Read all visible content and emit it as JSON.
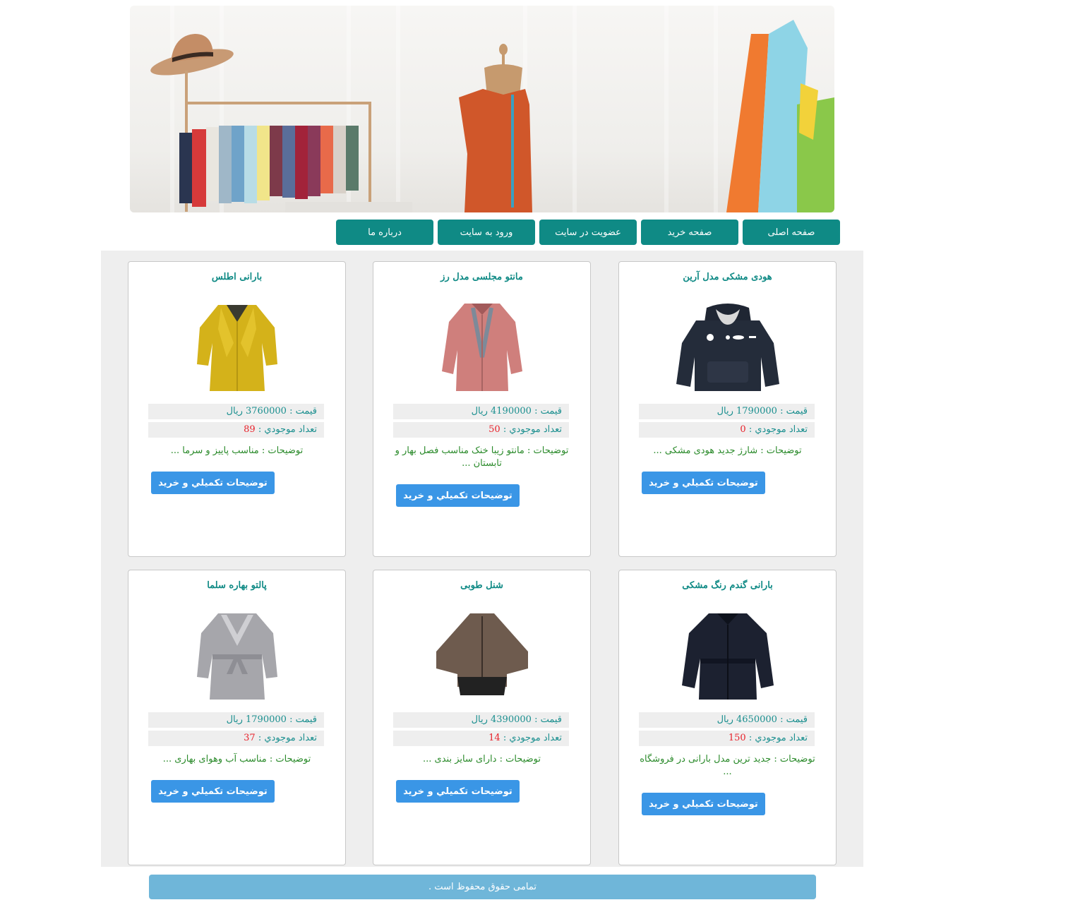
{
  "nav": {
    "items": [
      {
        "label": "صفحه اصلی"
      },
      {
        "label": "صفحه خرید"
      },
      {
        "label": "عضویت در سایت"
      },
      {
        "label": "ورود به سایت"
      },
      {
        "label": "درباره ما"
      }
    ]
  },
  "labels": {
    "price_prefix": "قیمت :",
    "currency": "ریال",
    "stock_prefix": "تعداد موجودي :",
    "desc_prefix": "توضیحات :",
    "buy_button": "توضيحات تکميلي و خريد"
  },
  "products": [
    {
      "title": "هودی مشکی مدل آرین",
      "price": "1790000",
      "stock": "0",
      "desc": "شارژ جدید هودی مشکی ...",
      "image_icon": "black-hoodie-image"
    },
    {
      "title": "مانتو مجلسی مدل رز",
      "price": "4190000",
      "stock": "50",
      "desc": "مانتو زیبا خنک مناسب فصل بهار و تابستان ...",
      "image_icon": "pink-coat-image"
    },
    {
      "title": "بارانی اطلس",
      "price": "3760000",
      "stock": "89",
      "desc": "مناسب پاییز و سرما ...",
      "image_icon": "yellow-raincoat-image"
    },
    {
      "title": "بارانی گندم رنگ مشکی",
      "price": "4650000",
      "stock": "150",
      "desc": "جدید ترین مدل بارانی در فروشگاه ...",
      "image_icon": "black-raincoat-image"
    },
    {
      "title": "شنل طوبی",
      "price": "4390000",
      "stock": "14",
      "desc": "دارای سایز بندی ...",
      "image_icon": "brown-cape-image"
    },
    {
      "title": "پالتو بهاره سلما",
      "price": "1790000",
      "stock": "37",
      "desc": "مناسب آب وهوای بهاری ...",
      "image_icon": "grey-coat-image"
    }
  ],
  "footer": {
    "text": "تمامی حقوق محفوظ است ."
  },
  "colors": {
    "nav": "#0f8a85",
    "title": "#0f8a85",
    "stock_value": "#e8212a",
    "description": "#2a8a2a",
    "buy_button": "#3a96e6",
    "footer": "#6fb6d9"
  }
}
